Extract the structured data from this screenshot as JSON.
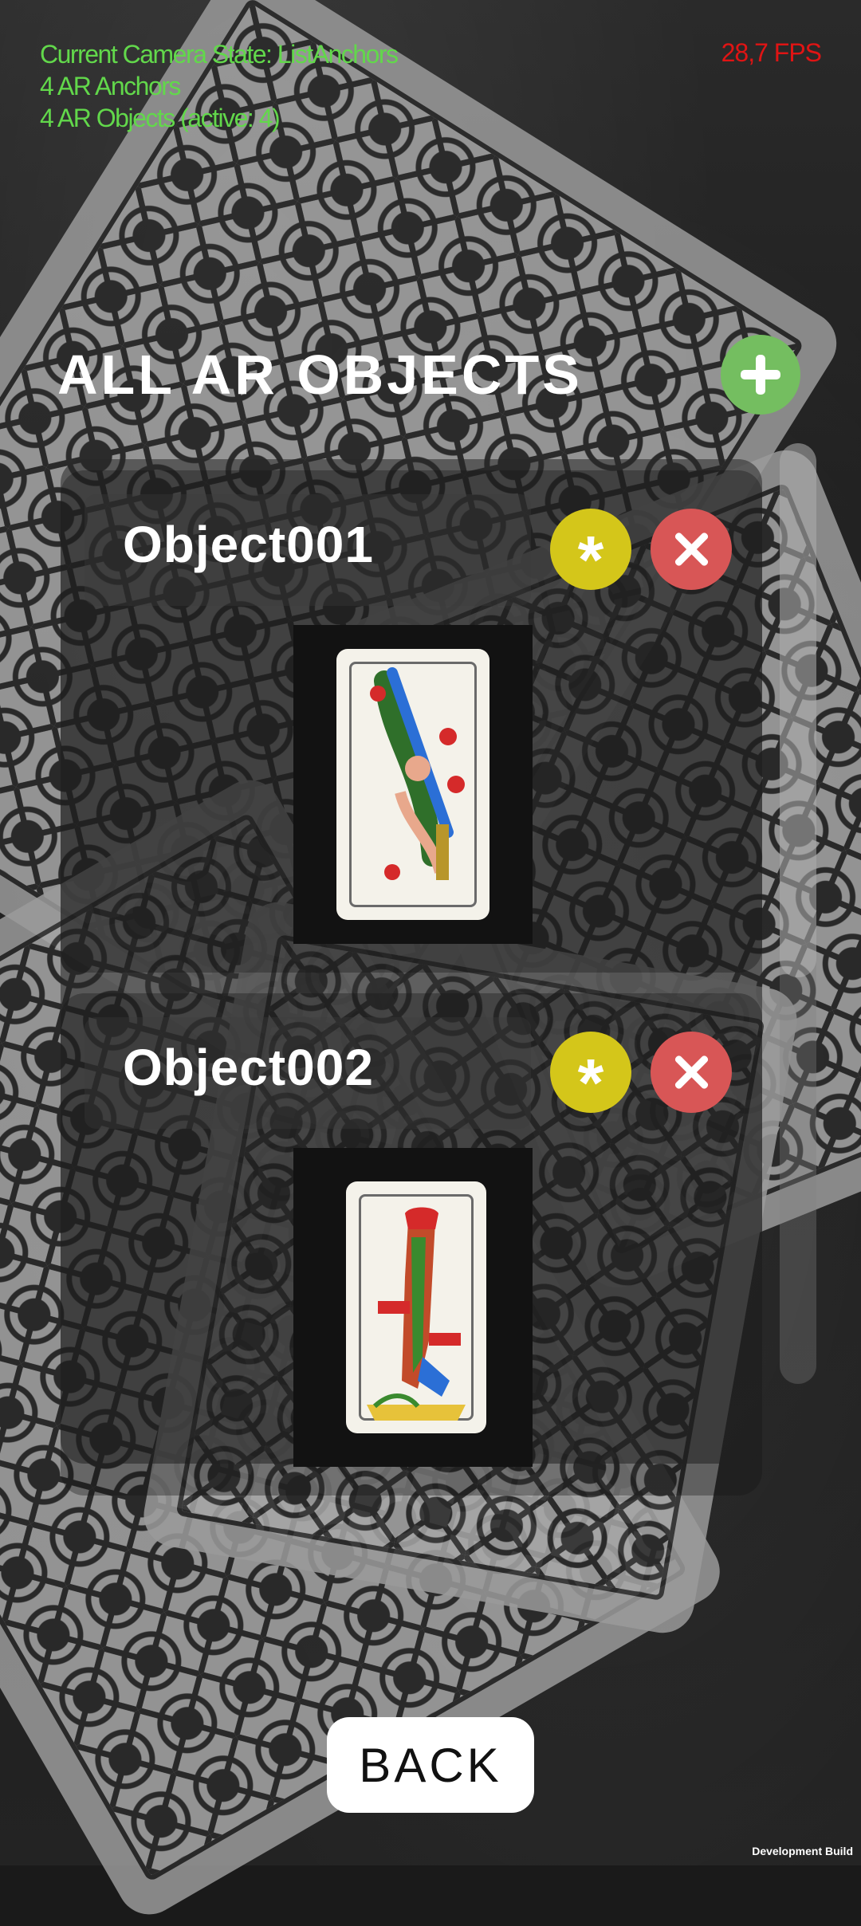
{
  "hud": {
    "camera_state": "Current Camera State: ListAnchors",
    "anchors": "4 AR Anchors",
    "objects": "4 AR Objects (active: 4)",
    "fps": "28,7 FPS"
  },
  "header": {
    "title": "ALL AR OBJECTS",
    "add_icon": "plus-icon"
  },
  "objects": [
    {
      "name": "Object001",
      "star_label": "*",
      "delete_icon": "close-icon"
    },
    {
      "name": "Object002",
      "star_label": "*",
      "delete_icon": "close-icon"
    }
  ],
  "back_button": {
    "label": "BACK"
  },
  "footer": {
    "build_label": "Development Build"
  },
  "colors": {
    "hud_text": "#62d84b",
    "fps_text": "#e01414",
    "add_button": "#74be60",
    "star_button": "#d4c61a",
    "delete_button": "#d85656"
  }
}
